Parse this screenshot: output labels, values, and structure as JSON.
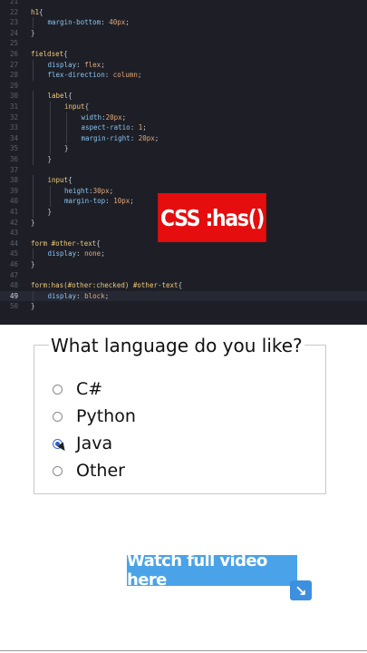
{
  "editor": {
    "lines": [
      {
        "n": "21",
        "indent": 0,
        "parts": []
      },
      {
        "n": "22",
        "indent": 0,
        "parts": [
          [
            "sel",
            "h1"
          ],
          [
            "pun",
            "{"
          ]
        ]
      },
      {
        "n": "23",
        "indent": 1,
        "parts": [
          [
            "prop",
            "margin-bottom"
          ],
          [
            "pun",
            ": "
          ],
          [
            "val",
            "40px"
          ],
          [
            "pun",
            ";"
          ]
        ]
      },
      {
        "n": "24",
        "indent": 0,
        "parts": [
          [
            "pun",
            "}"
          ]
        ]
      },
      {
        "n": "25",
        "indent": 0,
        "parts": []
      },
      {
        "n": "26",
        "indent": 0,
        "parts": [
          [
            "sel",
            "fieldset"
          ],
          [
            "pun",
            "{"
          ]
        ]
      },
      {
        "n": "27",
        "indent": 1,
        "parts": [
          [
            "prop",
            "display"
          ],
          [
            "pun",
            ": "
          ],
          [
            "val",
            "flex"
          ],
          [
            "pun",
            ";"
          ]
        ]
      },
      {
        "n": "28",
        "indent": 1,
        "parts": [
          [
            "prop",
            "flex-direction"
          ],
          [
            "pun",
            ": "
          ],
          [
            "val",
            "column"
          ],
          [
            "pun",
            ";"
          ]
        ]
      },
      {
        "n": "29",
        "indent": 0,
        "parts": []
      },
      {
        "n": "30",
        "indent": 1,
        "parts": [
          [
            "sel",
            "label"
          ],
          [
            "pun",
            "{"
          ]
        ]
      },
      {
        "n": "31",
        "indent": 2,
        "parts": [
          [
            "sel",
            "input"
          ],
          [
            "pun",
            "{"
          ]
        ]
      },
      {
        "n": "32",
        "indent": 3,
        "parts": [
          [
            "prop",
            "width"
          ],
          [
            "pun",
            ":"
          ],
          [
            "val",
            "20px"
          ],
          [
            "pun",
            ";"
          ]
        ]
      },
      {
        "n": "33",
        "indent": 3,
        "parts": [
          [
            "prop",
            "aspect-ratio"
          ],
          [
            "pun",
            ": "
          ],
          [
            "val",
            "1"
          ],
          [
            "pun",
            ";"
          ]
        ]
      },
      {
        "n": "34",
        "indent": 3,
        "parts": [
          [
            "prop",
            "margin-right"
          ],
          [
            "pun",
            ": "
          ],
          [
            "val",
            "20px"
          ],
          [
            "pun",
            ";"
          ]
        ]
      },
      {
        "n": "35",
        "indent": 2,
        "parts": [
          [
            "pun",
            "}"
          ]
        ]
      },
      {
        "n": "36",
        "indent": 1,
        "parts": [
          [
            "pun",
            "}"
          ]
        ]
      },
      {
        "n": "37",
        "indent": 0,
        "parts": []
      },
      {
        "n": "38",
        "indent": 1,
        "parts": [
          [
            "sel",
            "input"
          ],
          [
            "pun",
            "{"
          ]
        ]
      },
      {
        "n": "39",
        "indent": 2,
        "parts": [
          [
            "prop",
            "height"
          ],
          [
            "pun",
            ":"
          ],
          [
            "val",
            "30px"
          ],
          [
            "pun",
            ";"
          ]
        ]
      },
      {
        "n": "40",
        "indent": 2,
        "parts": [
          [
            "prop",
            "margin-top"
          ],
          [
            "pun",
            ": "
          ],
          [
            "val",
            "10px"
          ],
          [
            "pun",
            ";"
          ]
        ]
      },
      {
        "n": "41",
        "indent": 1,
        "parts": [
          [
            "pun",
            "}"
          ]
        ]
      },
      {
        "n": "42",
        "indent": 0,
        "parts": [
          [
            "pun",
            "}"
          ]
        ]
      },
      {
        "n": "43",
        "indent": 0,
        "parts": []
      },
      {
        "n": "44",
        "indent": 0,
        "parts": [
          [
            "sel",
            "form #other-text"
          ],
          [
            "pun",
            "{"
          ]
        ]
      },
      {
        "n": "45",
        "indent": 1,
        "parts": [
          [
            "prop",
            "display"
          ],
          [
            "pun",
            ": "
          ],
          [
            "val",
            "none"
          ],
          [
            "pun",
            ";"
          ]
        ]
      },
      {
        "n": "46",
        "indent": 0,
        "parts": [
          [
            "pun",
            "}"
          ]
        ]
      },
      {
        "n": "47",
        "indent": 0,
        "parts": []
      },
      {
        "n": "48",
        "indent": 0,
        "parts": [
          [
            "sel",
            "form:has(#other:checked) #other-text"
          ],
          [
            "pun",
            "{"
          ]
        ]
      },
      {
        "n": "49",
        "indent": 1,
        "active": true,
        "parts": [
          [
            "prop",
            "display"
          ],
          [
            "pun",
            ": "
          ],
          [
            "val",
            "block"
          ],
          [
            "pun",
            ";"
          ]
        ]
      },
      {
        "n": "50",
        "indent": 0,
        "parts": [
          [
            "pun",
            "}"
          ]
        ]
      }
    ]
  },
  "badge": {
    "text": "CSS :has()"
  },
  "form": {
    "legend": "What language do you like?",
    "options": [
      {
        "label": "C#",
        "checked": false
      },
      {
        "label": "Python",
        "checked": false
      },
      {
        "label": "Java",
        "checked": true
      },
      {
        "label": "Other",
        "checked": false
      }
    ]
  },
  "cta": {
    "label": "Watch full video here",
    "arrow": "↘"
  },
  "colors": {
    "badge": "#e50d0d",
    "cta": "#4aa3e8",
    "editor_bg": "#1e1f26"
  }
}
